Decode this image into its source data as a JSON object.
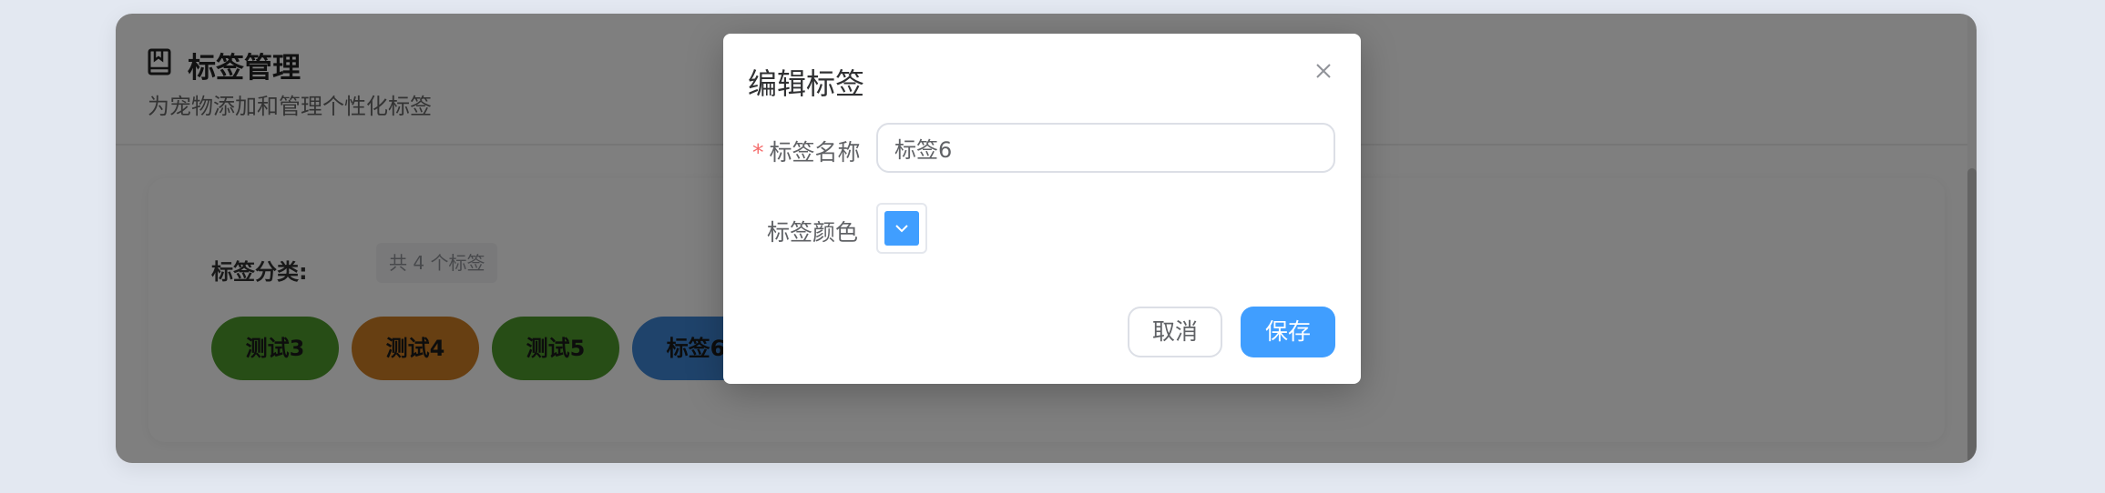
{
  "page": {
    "title": "标签管理",
    "subtitle": "为宠物添加和管理个性化标签",
    "category_label": "标签分类:",
    "count_badge": "共 4 个标签"
  },
  "tags": [
    {
      "label": "测试3",
      "color": "#4f9a2c"
    },
    {
      "label": "测试4",
      "color": "#cf7f24"
    },
    {
      "label": "测试5",
      "color": "#4f9a2c"
    },
    {
      "label": "标签6",
      "color": "#3e86d6"
    }
  ],
  "dialog": {
    "title": "编辑标签",
    "required_mark": "*",
    "name_label": "标签名称",
    "name_value": "标签6",
    "color_label": "标签颜色",
    "color_value": "#409eff",
    "cancel_label": "取消",
    "save_label": "保存",
    "save_color": "#409eff"
  },
  "icons": {
    "header": "book-icon",
    "close": "close-icon",
    "color_dropdown": "chevron-down-icon"
  }
}
